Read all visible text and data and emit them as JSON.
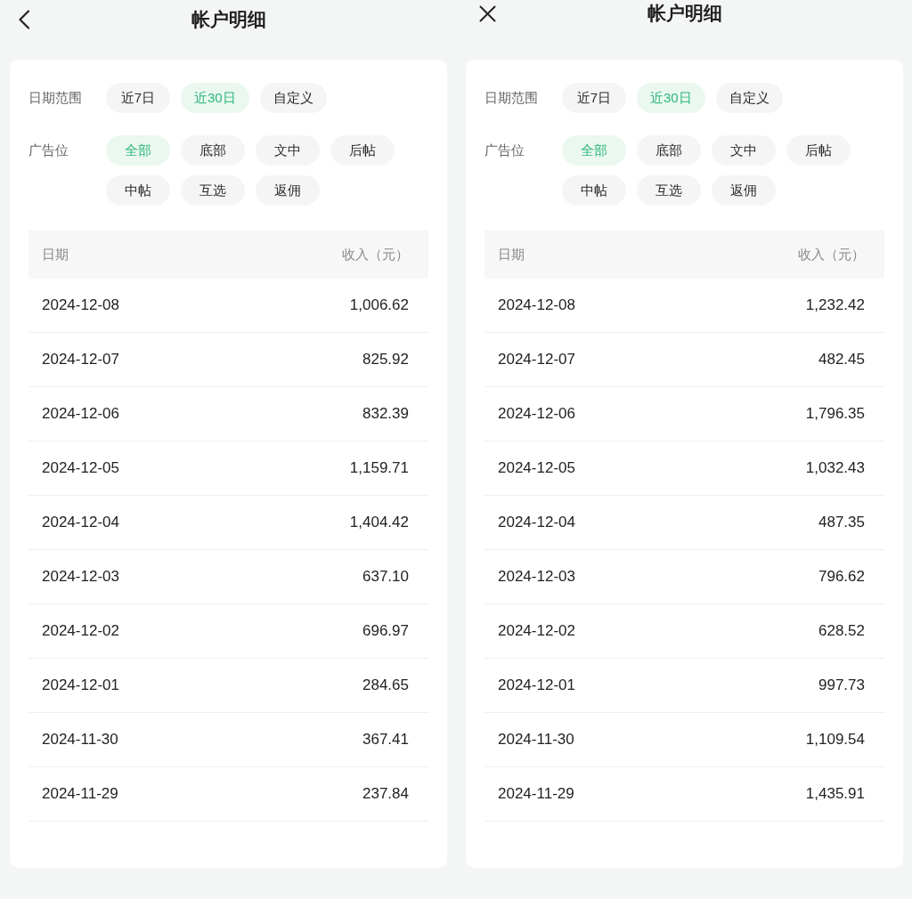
{
  "screens": [
    {
      "header": {
        "kind": "back",
        "title": "帐户明细"
      },
      "filters": [
        {
          "label": "日期范围",
          "options": [
            {
              "label": "近7日",
              "selected": false
            },
            {
              "label": "近30日",
              "selected": true
            },
            {
              "label": "自定义",
              "selected": false
            }
          ]
        },
        {
          "label": "广告位",
          "options": [
            {
              "label": "全部",
              "selected": true
            },
            {
              "label": "底部",
              "selected": false
            },
            {
              "label": "文中",
              "selected": false
            },
            {
              "label": "后帖",
              "selected": false
            },
            {
              "label": "中帖",
              "selected": false
            },
            {
              "label": "互选",
              "selected": false
            },
            {
              "label": "返佣",
              "selected": false
            }
          ]
        }
      ],
      "table": {
        "columns": [
          "日期",
          "收入（元）"
        ],
        "rows": [
          {
            "date": "2024-12-08",
            "income": "1,006.62"
          },
          {
            "date": "2024-12-07",
            "income": "825.92"
          },
          {
            "date": "2024-12-06",
            "income": "832.39"
          },
          {
            "date": "2024-12-05",
            "income": "1,159.71"
          },
          {
            "date": "2024-12-04",
            "income": "1,404.42"
          },
          {
            "date": "2024-12-03",
            "income": "637.10"
          },
          {
            "date": "2024-12-02",
            "income": "696.97"
          },
          {
            "date": "2024-12-01",
            "income": "284.65"
          },
          {
            "date": "2024-11-30",
            "income": "367.41"
          },
          {
            "date": "2024-11-29",
            "income": "237.84"
          }
        ]
      }
    },
    {
      "header": {
        "kind": "close",
        "title": "帐户明细"
      },
      "filters": [
        {
          "label": "日期范围",
          "options": [
            {
              "label": "近7日",
              "selected": false
            },
            {
              "label": "近30日",
              "selected": true
            },
            {
              "label": "自定义",
              "selected": false
            }
          ]
        },
        {
          "label": "广告位",
          "options": [
            {
              "label": "全部",
              "selected": true
            },
            {
              "label": "底部",
              "selected": false
            },
            {
              "label": "文中",
              "selected": false
            },
            {
              "label": "后帖",
              "selected": false
            },
            {
              "label": "中帖",
              "selected": false
            },
            {
              "label": "互选",
              "selected": false
            },
            {
              "label": "返佣",
              "selected": false
            }
          ]
        }
      ],
      "table": {
        "columns": [
          "日期",
          "收入（元）"
        ],
        "rows": [
          {
            "date": "2024-12-08",
            "income": "1,232.42"
          },
          {
            "date": "2024-12-07",
            "income": "482.45"
          },
          {
            "date": "2024-12-06",
            "income": "1,796.35"
          },
          {
            "date": "2024-12-05",
            "income": "1,032.43"
          },
          {
            "date": "2024-12-04",
            "income": "487.35"
          },
          {
            "date": "2024-12-03",
            "income": "796.62"
          },
          {
            "date": "2024-12-02",
            "income": "628.52"
          },
          {
            "date": "2024-12-01",
            "income": "997.73"
          },
          {
            "date": "2024-11-30",
            "income": "1,109.54"
          },
          {
            "date": "2024-11-29",
            "income": "1,435.91"
          }
        ]
      }
    }
  ]
}
